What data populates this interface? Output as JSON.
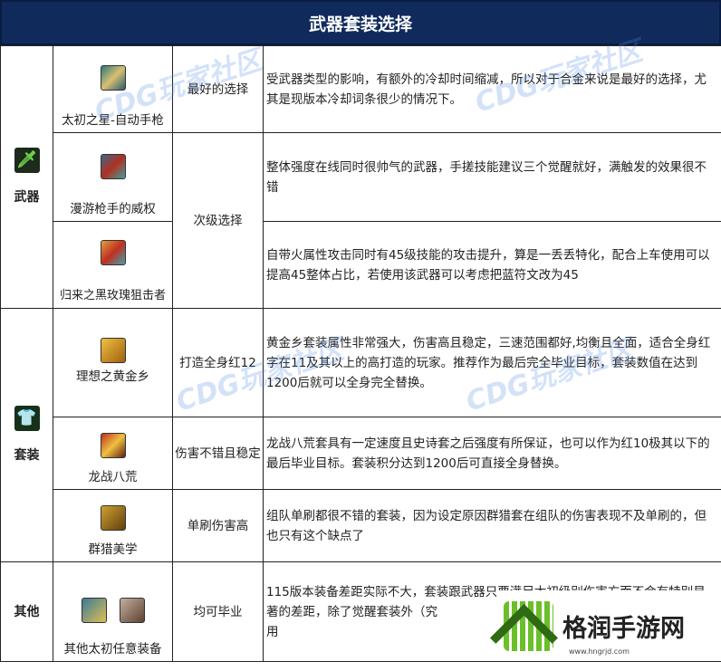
{
  "title": "武器套装选择",
  "categories": {
    "weapon": "武器",
    "set": "套装",
    "other": "其他"
  },
  "rows": [
    {
      "item": "太初之星-自动手枪",
      "rating": "最好的选择",
      "desc": "受武器类型的影响，有额外的冷却时间缩减，所以对于合金来说是最好的选择，尤其是现版本冷却词条很少的情况下。"
    },
    {
      "item": "漫游枪手的威权",
      "rating": "次级选择",
      "desc": "整体强度在线同时很帅气的武器，手搓技能建议三个觉醒就好，满触发的效果很不错"
    },
    {
      "item": "归来之黑玫瑰狙击者",
      "desc": "自带火属性攻击同时有45级技能的攻击提升，算是一丢丢特化，配合上车使用可以提高45整体占比，若使用该武器可以考虑把蓝符文改为45"
    },
    {
      "item": "理想之黄金乡",
      "rating": "打造全身红12",
      "desc": "黄金乡套装属性非常强大，伤害高且稳定，三速范围都好,均衡且全面，适合全身红字在11及其以上的高打造的玩家。推荐作为最后完全毕业目标，套装数值在达到1200后就可以全身完全替换。"
    },
    {
      "item": "龙战八荒",
      "rating": "伤害不错且稳定",
      "desc": "龙战八荒套具有一定速度且史诗套之后强度有所保证，也可以作为红10极其以下的最后毕业目标。套装积分达到1200后可直接全身替换。"
    },
    {
      "item": "群猎美学",
      "rating": "单刷伤害高",
      "desc": "组队单刷都很不错的套装，因为设定原因群猎套在组队的伤害表现不及单刷的，但也只有这个缺点了"
    },
    {
      "item": "其他太初任意装备",
      "rating": "均可毕业",
      "desc": "115版本装备差距实际不大，套装跟武器只要满足太初级别伤害方面不会有特别显著的差距，除了觉醒套装外（究",
      "desc_tail": "用"
    }
  ],
  "watermark": "CDG玩家社区",
  "logo": {
    "name": "格润手游网",
    "url": "www.hngrjd.com"
  },
  "colors": {
    "header": "#102a5c"
  }
}
